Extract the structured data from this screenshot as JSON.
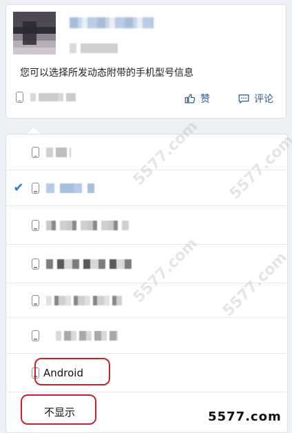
{
  "post": {
    "text": "您可以选择所发动态附带的手机型号信息",
    "like_label": "赞",
    "comment_label": "评论"
  },
  "menu": {
    "options": [
      {
        "type": "blurred",
        "selected": false
      },
      {
        "type": "blurred",
        "selected": true
      },
      {
        "type": "blurred",
        "selected": false
      },
      {
        "type": "blurred",
        "selected": false
      },
      {
        "type": "blurred",
        "selected": false
      },
      {
        "type": "blurred",
        "selected": false
      },
      {
        "type": "text",
        "label": "Android",
        "selected": false
      },
      {
        "type": "text",
        "label": "不显示",
        "selected": false
      }
    ],
    "check_mark": "✔",
    "android_label": "Android",
    "hide_label": "不显示"
  },
  "watermark": {
    "text": "5577.com",
    "faint_text": "5577.com"
  },
  "colors": {
    "accent": "#2b5c99",
    "check": "#2b7bd8",
    "highlight": "#c8202a"
  }
}
